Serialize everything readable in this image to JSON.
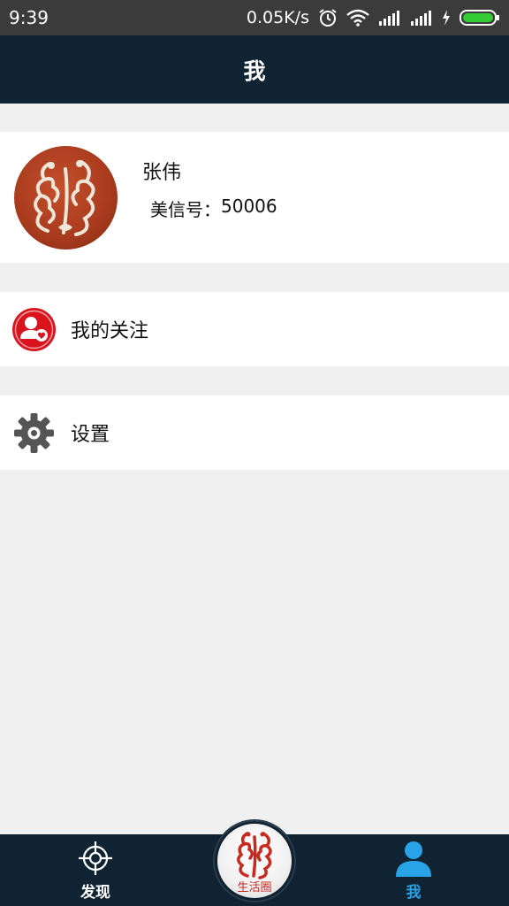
{
  "status_bar": {
    "time": "9:39",
    "network_speed": "0.05K/s",
    "icons": [
      "alarm-icon",
      "wifi-icon",
      "signal-icon",
      "signal-icon",
      "charging-icon",
      "battery-icon"
    ]
  },
  "header": {
    "title": "我"
  },
  "profile": {
    "name": "张伟",
    "id_label": "美信号：",
    "id_value": "50006",
    "avatar_icon": "dragon-phoenix-avatar"
  },
  "menu": {
    "follow_label": "我的关注",
    "follow_icon": "user-heart-icon",
    "settings_label": "设置",
    "settings_icon": "gear-icon"
  },
  "bottom_nav": {
    "discover_label": "发现",
    "discover_icon": "crosshair-icon",
    "center_label": "生活圈",
    "center_icon": "dragon-phoenix-logo",
    "me_label": "我",
    "me_icon": "user-icon",
    "active": "me"
  },
  "colors": {
    "header_bg": "#0f2333",
    "status_bar_bg": "#3b3b3b",
    "page_bg": "#f0f0f0",
    "active_tab": "#29a3e8",
    "follow_icon_bg": "#d9141d",
    "avatar_bg": "#a83a1d",
    "center_label": "#c8281e"
  }
}
